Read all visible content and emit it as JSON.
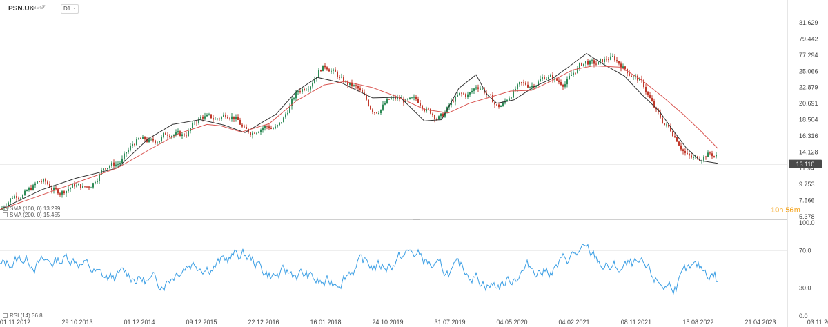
{
  "header": {
    "symbol": "PSN.UK",
    "symbol_sub": "BVG",
    "timeframe": "D1"
  },
  "legend": {
    "sma1": "SMA (100, 0)  13.299",
    "sma2": "SMA (200, 0)  15.455",
    "rsi": "RSI (14)  36.8"
  },
  "timer": {
    "hours": "10",
    "h": "h",
    "minutes": "56",
    "m": "m"
  },
  "colors": {
    "bull": "#2e8b57",
    "bear": "#c0392b",
    "sma_fast": "#333333",
    "sma_slow": "#d9534f",
    "rsi": "#3a9ee4",
    "price_tag": "#4a4a4a"
  },
  "chart_data": [
    {
      "type": "candlestick",
      "title": "PSN.UK",
      "y_tick_labels": [
        "31.629",
        "79.442",
        "77.294",
        "25.066",
        "22.879",
        "20.691",
        "18.504",
        "16.316",
        "14.128",
        "11.941",
        "9.753",
        "7.566",
        "5.378"
      ],
      "current_price": "13.110",
      "x_tick_labels": [
        "01.11.2012",
        "29.10.2013",
        "01.12.2014",
        "09.12.2015",
        "22.12.2016",
        "16.01.2018",
        "24.10.2019",
        "31.07.2019",
        "04.05.2020",
        "04.02.2021",
        "08.11.2021",
        "15.08.2022",
        "21.04.2023",
        "03.11.2023"
      ],
      "series": [
        {
          "name": "SMA (100, 0)",
          "role": "sma_fast",
          "points": [
            [
              0,
              6.4
            ],
            [
              60,
              9.3
            ],
            [
              110,
              11.0
            ],
            [
              170,
              12.5
            ],
            [
              215,
              16.8
            ],
            [
              250,
              18.9
            ],
            [
              290,
              19.6
            ],
            [
              325,
              18.8
            ],
            [
              355,
              17.7
            ],
            [
              400,
              20.4
            ],
            [
              430,
              23.8
            ],
            [
              460,
              25.8
            ],
            [
              495,
              25.0
            ],
            [
              540,
              22.8
            ],
            [
              580,
              22.9
            ],
            [
              615,
              19.4
            ],
            [
              640,
              19.6
            ],
            [
              665,
              24.2
            ],
            [
              690,
              26.2
            ],
            [
              705,
              23.4
            ],
            [
              720,
              22.0
            ],
            [
              745,
              22.5
            ],
            [
              775,
              24.5
            ],
            [
              800,
              25.6
            ],
            [
              825,
              27.4
            ],
            [
              850,
              29.3
            ],
            [
              875,
              27.7
            ],
            [
              905,
              26.0
            ],
            [
              930,
              23.3
            ],
            [
              955,
              20.9
            ],
            [
              975,
              18.1
            ],
            [
              995,
              15.4
            ],
            [
              1015,
              13.6
            ],
            [
              1040,
              13.2
            ]
          ]
        },
        {
          "name": "SMA (200, 0)",
          "role": "sma_slow",
          "points": [
            [
              0,
              6.4
            ],
            [
              70,
              8.9
            ],
            [
              120,
              10.7
            ],
            [
              170,
              12.5
            ],
            [
              220,
              15.4
            ],
            [
              260,
              17.6
            ],
            [
              300,
              18.9
            ],
            [
              320,
              18.7
            ],
            [
              350,
              17.8
            ],
            [
              390,
              19.0
            ],
            [
              430,
              22.4
            ],
            [
              470,
              24.7
            ],
            [
              500,
              25.2
            ],
            [
              540,
              24.3
            ],
            [
              580,
              22.8
            ],
            [
              615,
              21.1
            ],
            [
              650,
              20.6
            ],
            [
              680,
              22.0
            ],
            [
              710,
              22.9
            ],
            [
              740,
              23.8
            ],
            [
              770,
              23.9
            ],
            [
              800,
              25.3
            ],
            [
              830,
              26.9
            ],
            [
              860,
              27.5
            ],
            [
              900,
              27.3
            ],
            [
              930,
              25.4
            ],
            [
              960,
              23.0
            ],
            [
              990,
              20.4
            ],
            [
              1015,
              18.0
            ],
            [
              1040,
              15.4
            ]
          ]
        }
      ]
    },
    {
      "type": "line",
      "title": "RSI (14)",
      "y_tick_labels": [
        "100.0",
        "70.0",
        "30.0",
        "0.0"
      ],
      "ylim": [
        0,
        100
      ],
      "guide_levels": [
        70,
        30
      ],
      "last_value": 36.8
    }
  ]
}
